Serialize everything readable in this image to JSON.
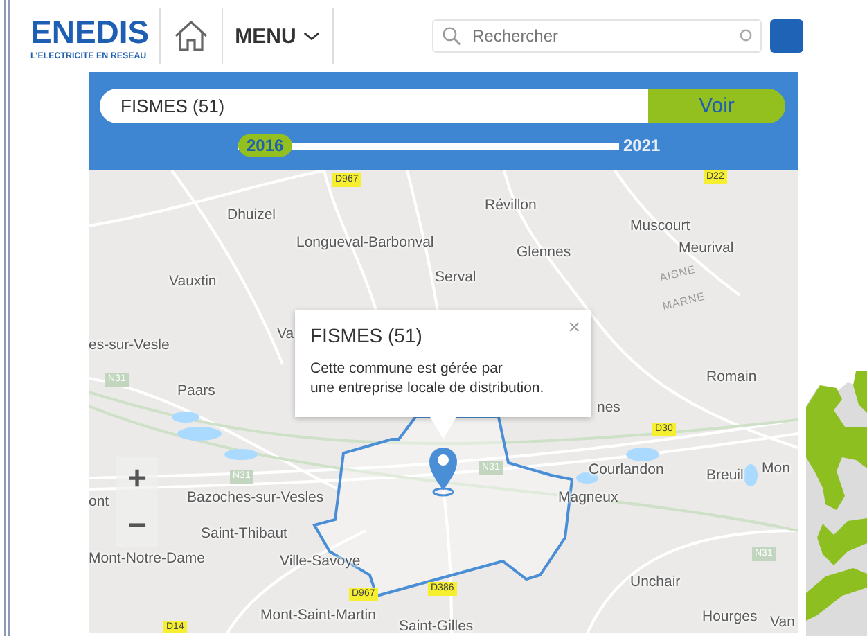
{
  "header": {
    "logo": {
      "wordmark": "ENEDIS",
      "tagline": "L'ELECTRICITE EN RESEAU"
    },
    "menu": {
      "label": "MENU"
    },
    "search": {
      "placeholder": "Rechercher"
    }
  },
  "commune_search": {
    "value": "FISMES (51)",
    "button": "Voir"
  },
  "year_slider": {
    "start_label": "2016",
    "end_label": "2021",
    "level": 0
  },
  "map": {
    "place_labels": [
      "Dhuizel",
      "Révillon",
      "Muscourt",
      "Longueval-Barbonval",
      "Glennes",
      "Meurival",
      "Serval",
      "Vauxtin",
      "es-sur-Vesle",
      "Va",
      "Romain",
      "Paars",
      "nes",
      "Courlandon",
      "Breuil",
      "Mon",
      "ont",
      "Bazoches-sur-Vesles",
      "Magneux",
      "Saint-Thibaut",
      "Mont-Notre-Dame",
      "Ville-Savoye",
      "Unchair",
      "Mont-Saint-Martin",
      "Saint-Gilles",
      "Hourges",
      "Van"
    ],
    "road_labels": [
      {
        "text": "D967",
        "kind": "departmental"
      },
      {
        "text": "D22",
        "kind": "departmental"
      },
      {
        "text": "N31",
        "kind": "national"
      },
      {
        "text": "D30",
        "kind": "departmental"
      },
      {
        "text": "N31",
        "kind": "national"
      },
      {
        "text": "N31",
        "kind": "national"
      },
      {
        "text": "N31",
        "kind": "national"
      },
      {
        "text": "D967",
        "kind": "departmental"
      },
      {
        "text": "D386",
        "kind": "departmental"
      },
      {
        "text": "D14",
        "kind": "departmental"
      }
    ],
    "boundary_labels": [
      "AISNE",
      "MARNE"
    ],
    "zoom_in": "+",
    "zoom_out": "−",
    "popup": {
      "title": "FISMES (51)",
      "text": "Cette commune est gérée par\nune entreprise locale de distribution.",
      "close": "×"
    }
  }
}
